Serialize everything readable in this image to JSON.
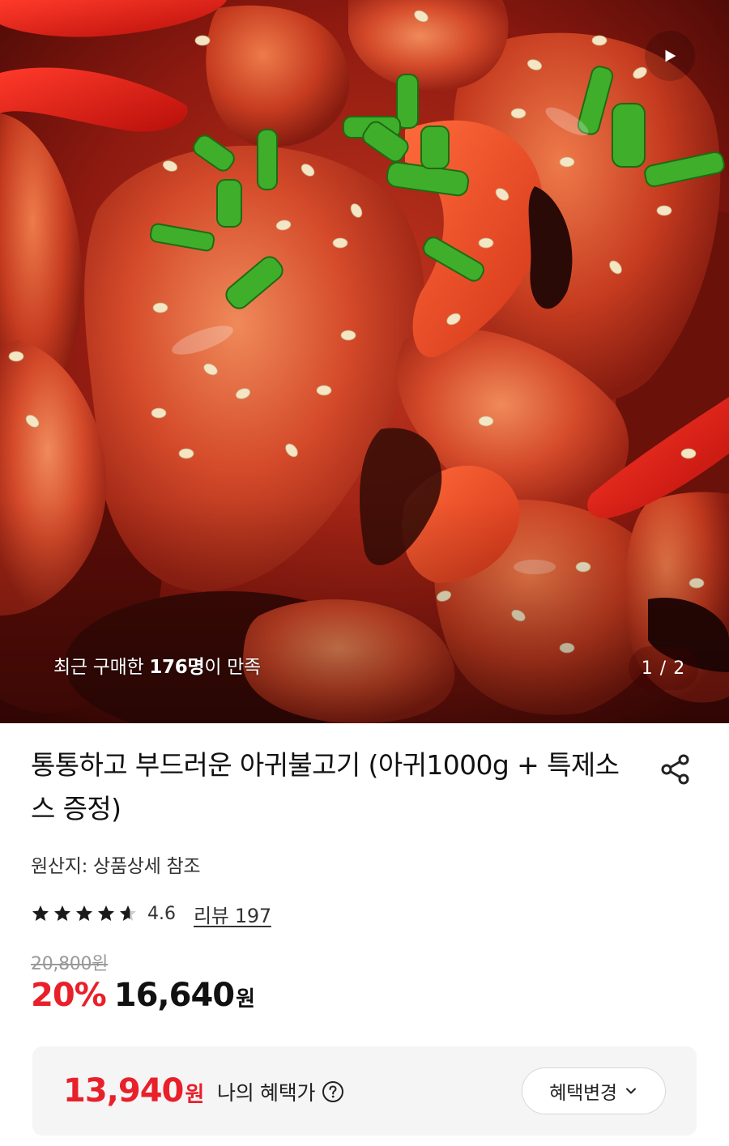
{
  "hero": {
    "image_alt": "",
    "purchase_note_prefix": "최근 구매한 ",
    "purchase_note_count": "176명",
    "purchase_note_suffix": "이 만족",
    "page_indicator": "1 / 2",
    "video_icon": "play-icon"
  },
  "product": {
    "title": "통통하고 부드러운 아귀불고기 (아귀1000g + 특제소스 증정)",
    "share_icon": "share-icon",
    "origin": "원산지: 상품상세 참조",
    "rating": {
      "stars_value": 4.6,
      "stars_max": 5,
      "value_text": "4.6",
      "review_link": "리뷰 197"
    },
    "price": {
      "original": "20,800원",
      "discount": "20%",
      "sale": "16,640",
      "sale_unit": "원"
    }
  },
  "benefit": {
    "amount": "13,940",
    "unit": "원",
    "label": "나의 혜택가",
    "help_icon": "question-circle-icon",
    "change_button": "혜택변경",
    "change_icon": "chevron-down-icon"
  },
  "colors": {
    "accent_red": "#e8202a",
    "text_primary": "#111111",
    "text_muted": "#999999",
    "benefit_bg": "#f5f5f6"
  }
}
